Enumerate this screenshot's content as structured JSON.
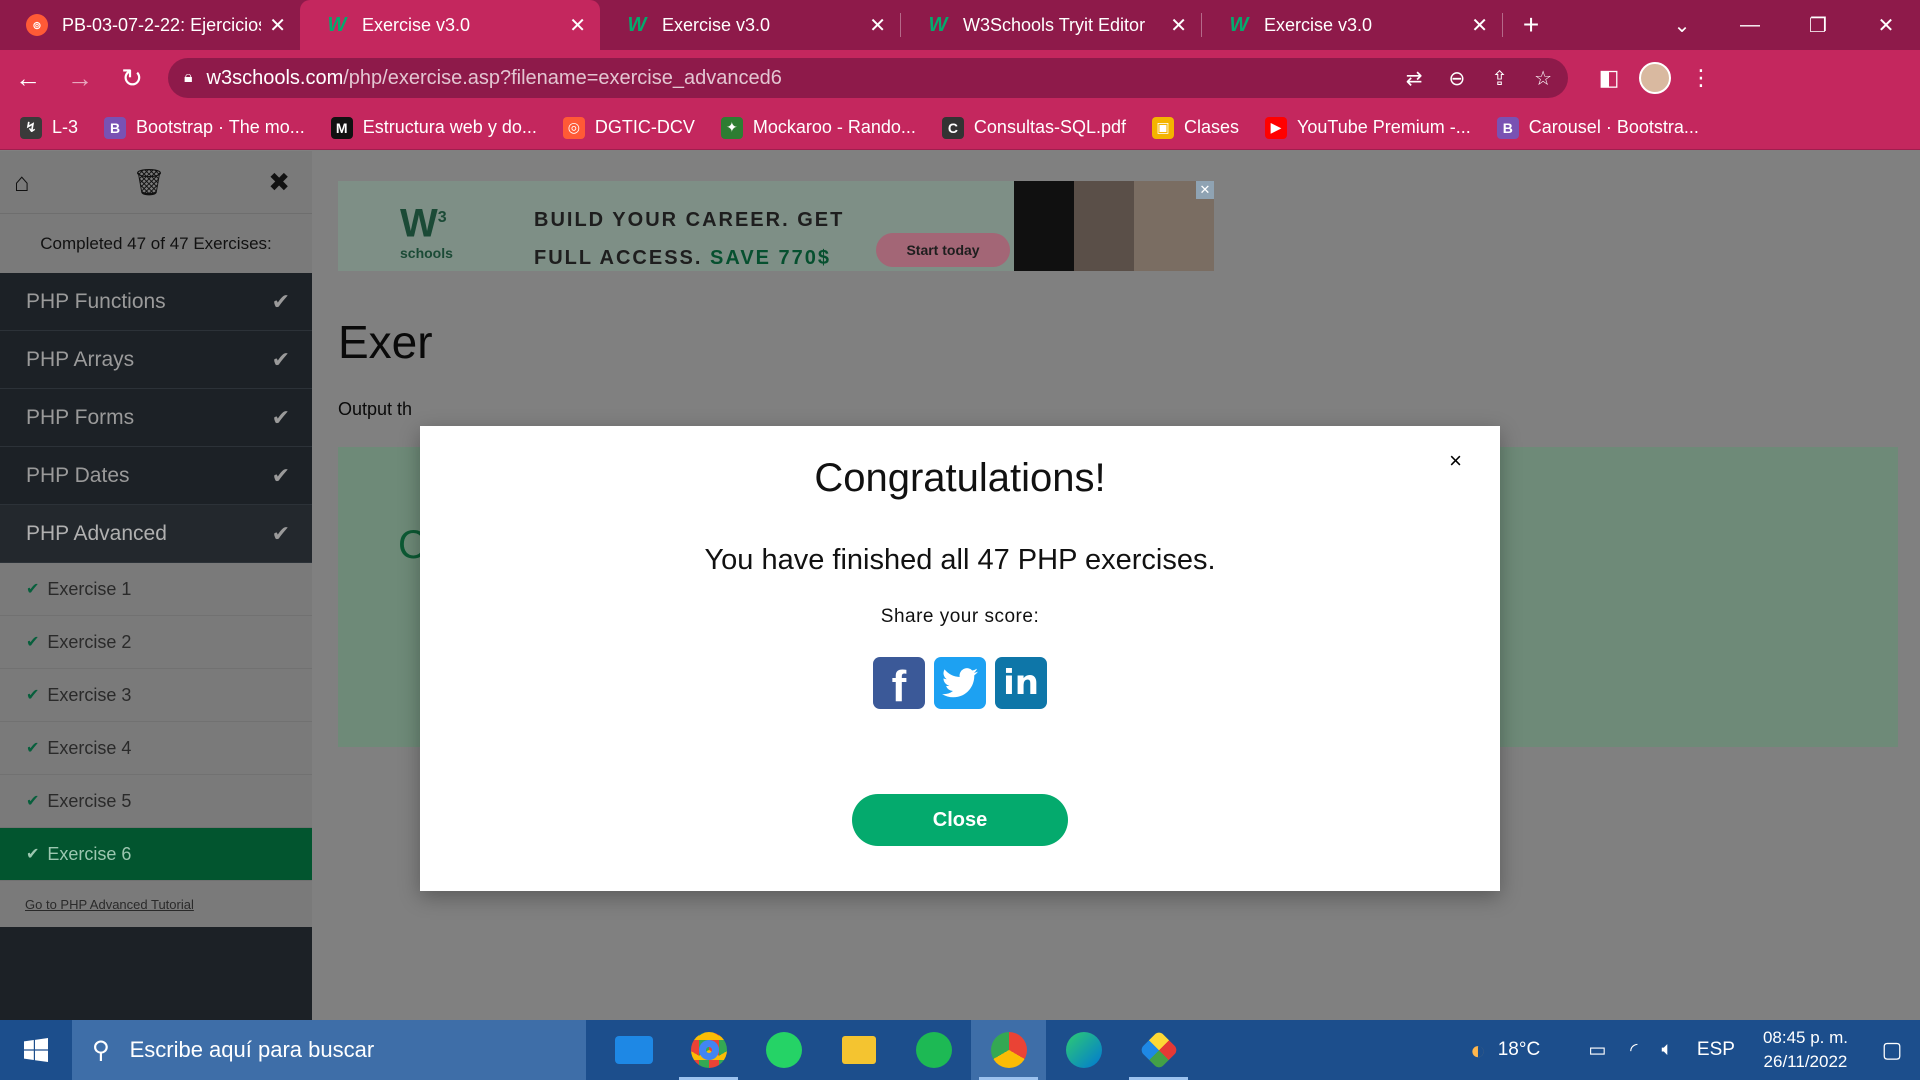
{
  "browser": {
    "tabs": [
      {
        "title": "PB-03-07-2-22: Ejercicios",
        "favicon": "pb-icon",
        "active": false
      },
      {
        "title": "Exercise v3.0",
        "favicon": "w3-icon",
        "active": true
      },
      {
        "title": "Exercise v3.0",
        "favicon": "w3-icon",
        "active": false
      },
      {
        "title": "W3Schools Tryit Editor",
        "favicon": "w3-icon",
        "active": false
      },
      {
        "title": "Exercise v3.0",
        "favicon": "w3-icon",
        "active": false
      }
    ],
    "url_host": "w3schools.com",
    "url_path": "/php/exercise.asp?filename=exercise_advanced6",
    "bookmarks": [
      {
        "label": "L-3",
        "color": "#3a3a3a",
        "glyph": "↯"
      },
      {
        "label": "Bootstrap · The mo...",
        "color": "#7952b3",
        "glyph": "B"
      },
      {
        "label": "Estructura web y do...",
        "color": "#111111",
        "glyph": "M"
      },
      {
        "label": "DGTIC-DCV",
        "color": "#ff5a36",
        "glyph": "◎"
      },
      {
        "label": "Mockaroo - Rando...",
        "color": "#2e7d32",
        "glyph": "✦"
      },
      {
        "label": "Consultas-SQL.pdf",
        "color": "#333333",
        "glyph": "C"
      },
      {
        "label": "Clases",
        "color": "#f4b400",
        "glyph": "▣"
      },
      {
        "label": "YouTube Premium -...",
        "color": "#ff0000",
        "glyph": "▶"
      },
      {
        "label": "Carousel · Bootstra...",
        "color": "#7952b3",
        "glyph": "B"
      }
    ]
  },
  "sidebar": {
    "completed_text": "Completed 47 of 47 Exercises:",
    "categories": [
      "PHP Functions",
      "PHP Arrays",
      "PHP Forms",
      "PHP Dates",
      "PHP Advanced"
    ],
    "exercises": [
      "Exercise 1",
      "Exercise 2",
      "Exercise 3",
      "Exercise 4",
      "Exercise 5",
      "Exercise 6"
    ],
    "tutorial_link": "Go to PHP Advanced Tutorial"
  },
  "ad": {
    "logo": "W",
    "logo_sup": "3",
    "logo_sub": "schools",
    "line1": "BUILD YOUR CAREER. GET",
    "line2_a": "FULL ACCESS.",
    "line2_b": "SAVE 770$",
    "button": "Start today"
  },
  "content": {
    "title_partial": "Exer",
    "desc_partial": "Output th",
    "code_glyph": "C"
  },
  "modal": {
    "title": "Congratulations!",
    "message": "You have finished all 47 PHP exercises.",
    "share_label": "Share your score:",
    "close_label": "Close",
    "close_x": "×"
  },
  "taskbar": {
    "search_placeholder": "Escribe aquí para buscar",
    "temperature": "18°C",
    "language": "ESP",
    "time": "08:45 p. m.",
    "date": "26/11/2022"
  },
  "colors": {
    "w3_green": "#04aa6d",
    "chrome_dark": "#8e1a4a",
    "chrome_light": "#c4275e",
    "facebook": "#3b5998",
    "twitter": "#1da1f2",
    "linkedin": "#0e76a8"
  }
}
